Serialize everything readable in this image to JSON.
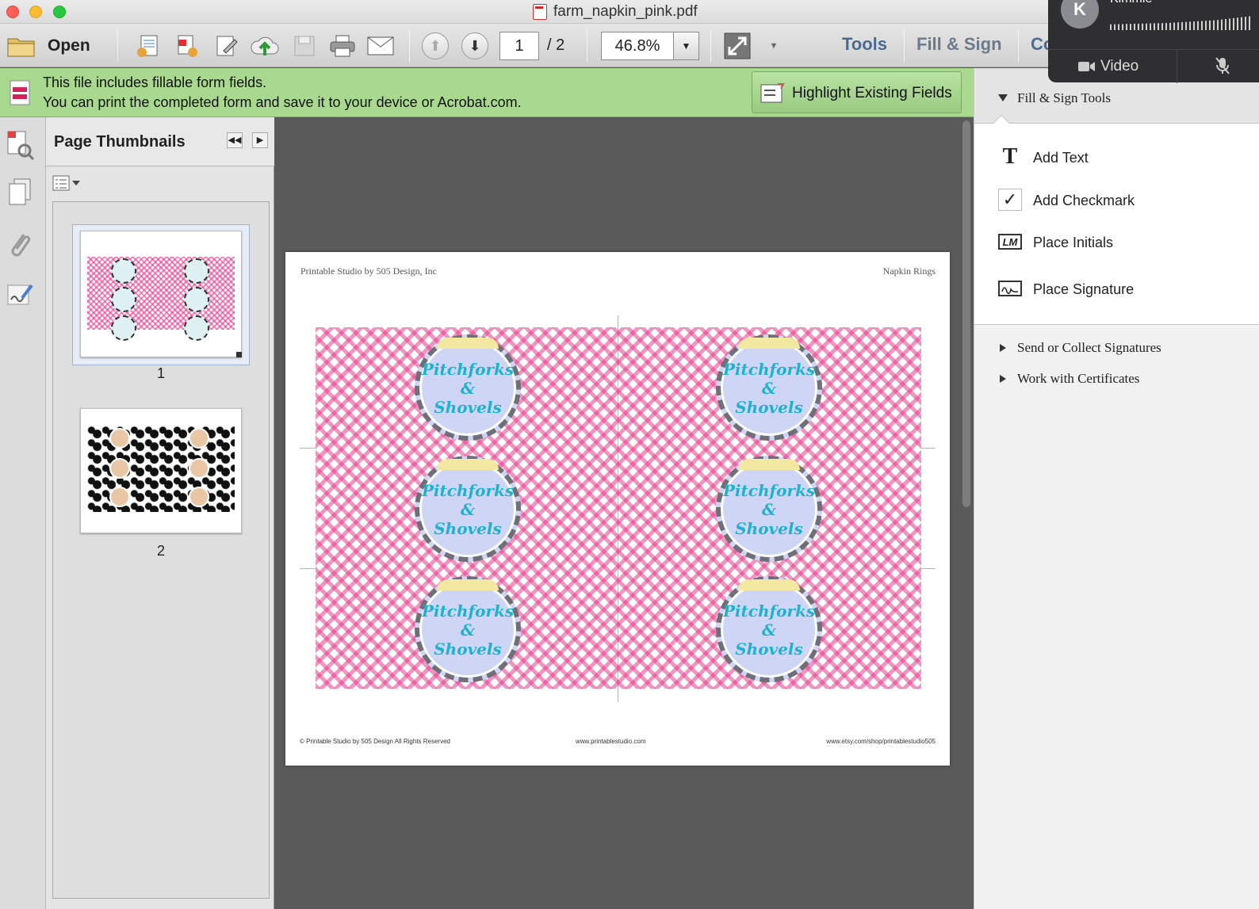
{
  "window": {
    "title": "farm_napkin_pink.pdf"
  },
  "toolbar": {
    "open_label": "Open",
    "page_current": "1",
    "page_total": "/ 2",
    "zoom": "46.8%",
    "tools_label": "Tools",
    "fill_sign_label": "Fill & Sign",
    "comment_label_partial": "Co"
  },
  "form_bar": {
    "message_line1": "This file includes fillable form fields.",
    "message_line2": "You can print the completed form and save it to your device or Acrobat.com.",
    "highlight_button": "Highlight Existing Fields"
  },
  "thumbnails": {
    "title": "Page Thumbnails",
    "pages": [
      {
        "number": "1",
        "selected": true
      },
      {
        "number": "2",
        "selected": false
      }
    ]
  },
  "document": {
    "header_left": "Printable Studio by 505 Design, Inc",
    "header_right": "Napkin Rings",
    "badge_text": [
      "Pitchforks",
      "&",
      "Shovels"
    ],
    "badge_count": 6,
    "footer_left": "© Printable Studio by 505 Design All Rights Reserved",
    "footer_mid": "www.printablestudio.com",
    "footer_right": "www.etsy.com/shop/printablestudio505"
  },
  "right_panel": {
    "fill_sign_tools_header": "Fill & Sign Tools",
    "tools": [
      {
        "label": "Add Text",
        "icon": "text-T-icon"
      },
      {
        "label": "Add Checkmark",
        "icon": "checkmark-icon"
      },
      {
        "label": "Place Initials",
        "icon": "initials-icon"
      },
      {
        "label": "Place Signature",
        "icon": "signature-icon"
      }
    ],
    "send_collect": "Send or Collect Signatures",
    "certificates": "Work with Certificates"
  },
  "video_overlay": {
    "avatar_letter": "K",
    "user_name": "Kimmie",
    "video_label": "Video"
  },
  "colors": {
    "form_bar": "#a9d98f",
    "link_blue": "#4a6c93",
    "gingham_pink": "#e83c8c",
    "badge_text": "#1fb2cf"
  }
}
